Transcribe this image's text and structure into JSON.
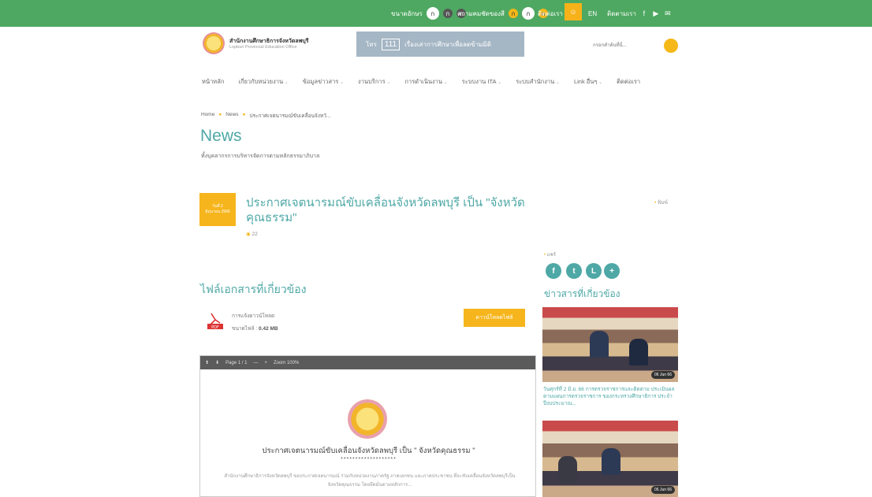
{
  "topbar": {
    "font_size_label": "ขนาดอักษร",
    "font_size_a1": "ก",
    "font_size_a2": "ก",
    "font_size_a3": "ก",
    "contrast_label": "ความคมชัดของสี",
    "contrast_c1": "ก",
    "contrast_c2": "ก",
    "contrast_c3": "ก",
    "contact_label": "ติดต่อเรา",
    "lang": "EN",
    "follow_label": "ติดตามเรา"
  },
  "header": {
    "org_name": "สำนักงานศึกษาธิการจังหวัดลพบุรี",
    "org_sub": "Lopburi Provincial Education Office",
    "banner_prefix": "โทร",
    "banner_number": "111",
    "banner_text": "เรื่องเล่าการศึกษาเพื่อลดข้ามมิติ",
    "search_placeholder": "กรอกคำค้นที่นี่..."
  },
  "nav": [
    "หน้าหลัก",
    "เกี่ยวกับหน่วยงาน",
    "ข้อมูลข่าวสาร",
    "งานบริการ",
    "การดำเนินงาน",
    "ระบบงาน ITA",
    "ระบบสำนักงาน",
    "Link อื่นๆ",
    "ติดต่อเรา"
  ],
  "breadcrumb": {
    "home": "Home",
    "news": "News",
    "current": "ประกาศเจตนารมณ์ขับเคลื่อนจังหวั..."
  },
  "page": {
    "title": "News",
    "subtitle": "ทั้งบุคลากรการบริหารจัดการตามหลักธรรมาภิบาล"
  },
  "article": {
    "date_line1": "วันที่ 2",
    "date_line2": "มิถุนายน 2566",
    "title": "ประกาศเจตนารมณ์ขับเคลื่อนจังหวัดลพบุรี เป็น \"จังหวัดคุณธรรม\"",
    "views": "22",
    "print": "พิมพ์"
  },
  "share": {
    "label": "แชร์",
    "buttons": [
      "f",
      "t",
      "L",
      "+"
    ]
  },
  "files": {
    "title": "ไฟล์เอกสารที่เกี่ยวข้อง",
    "file_name": "การแจ้งดาวน์โหลด",
    "size_label": "ขนาดไฟล์ : ",
    "size_value": "0.42 MB",
    "download_label": "ดาวน์โหลดไฟล์"
  },
  "viewer": {
    "page_label": "Page 1 / 1",
    "zoom_label": "Zoom 100%",
    "doc_title": "ประกาศเจตนารมณ์ขับเคลื่อนจังหวัดลพบุรี เป็น \" จังหวัดคุณธรรม \"",
    "doc_stars": "*******************",
    "doc_body": "สำนักงานศึกษาธิการจังหวัดลพบุรี ขอประกาศเจตนารมณ์ ร่วมกับหน่วยงานภาครัฐ ภาคเอกชน และภาคประชาชน ที่จะขับเคลื่อนจังหวัดลพบุรีเป็นจังหวัดคุณธรรม โดยยึดมั่นตามหลักการ..."
  },
  "related": {
    "title": "ข่าวสารที่เกี่ยวข้อง",
    "news1_badge": "06 Jun 66",
    "news1_caption": "วันศุกร์ที่ 2 มิ.ย. 66 การตรวจราชการและติดตาม ประเมินผล ตามแผนการตรวจราชการ ของกระทรวงศึกษาธิการ ประจำปีงบประมาณ...",
    "news2_badge": "06 Jun 66"
  },
  "colors": {
    "green": "#4ea861",
    "teal": "#4ea8a6",
    "yellow": "#f6b51c"
  }
}
